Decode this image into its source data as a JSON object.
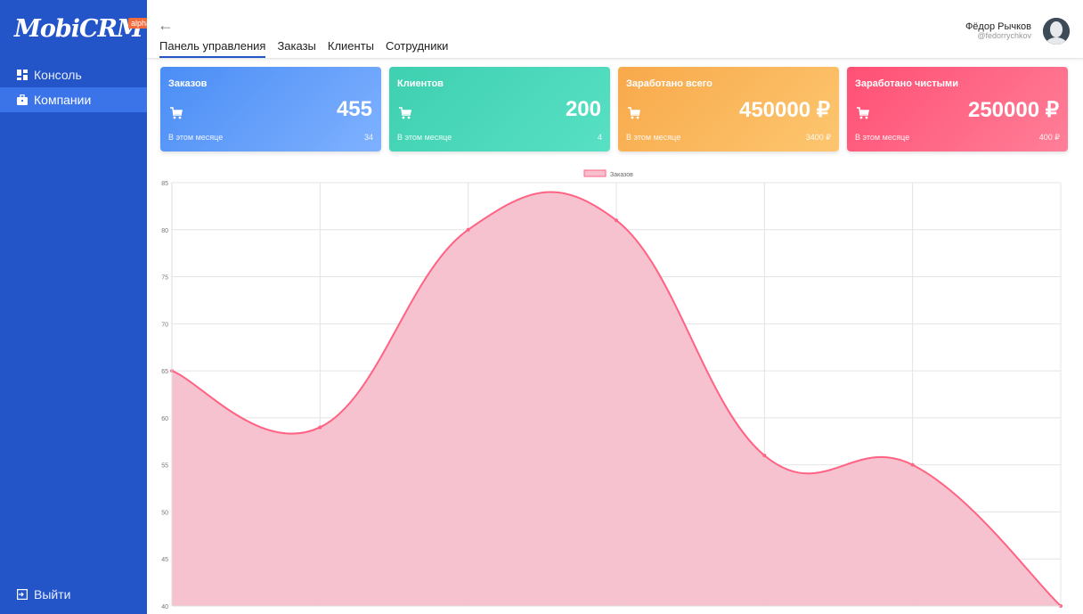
{
  "sidebar": {
    "logo": "MobiCRM",
    "badge": "alpha",
    "items": [
      {
        "label": "Консоль",
        "icon": "dashboard-icon"
      },
      {
        "label": "Компании",
        "icon": "briefcase-icon"
      }
    ],
    "logout": "Выйти"
  },
  "header": {
    "tabs": [
      {
        "label": "Панель управления"
      },
      {
        "label": "Заказы"
      },
      {
        "label": "Клиенты"
      },
      {
        "label": "Сотрудники"
      }
    ],
    "user": {
      "name": "Фёдор Рычков",
      "handle": "@fedorrychkov"
    }
  },
  "cards": [
    {
      "title": "Заказов",
      "value": "455",
      "sub": "В этом месяце",
      "delta": "34"
    },
    {
      "title": "Клиентов",
      "value": "200",
      "sub": "В этом месяце",
      "delta": "4"
    },
    {
      "title": "Заработано всего",
      "value": "450000 ₽",
      "sub": "В этом месяце",
      "delta": "3400 ₽"
    },
    {
      "title": "Заработано чистыми",
      "value": "250000 ₽",
      "sub": "В этом месяце",
      "delta": "400 ₽"
    }
  ],
  "colors": {
    "sidebar": "#2355c9",
    "line": "#ff6384",
    "fill": "#f7bfcd"
  },
  "chart_data": {
    "type": "area",
    "series": [
      {
        "name": "Заказов",
        "values": [
          65,
          59,
          80,
          81,
          56,
          55,
          40
        ]
      }
    ],
    "ylim": [
      40,
      85
    ],
    "yticks": [
      40,
      45,
      50,
      55,
      60,
      65,
      70,
      75,
      80,
      85
    ],
    "grid": true,
    "legend": "top"
  }
}
